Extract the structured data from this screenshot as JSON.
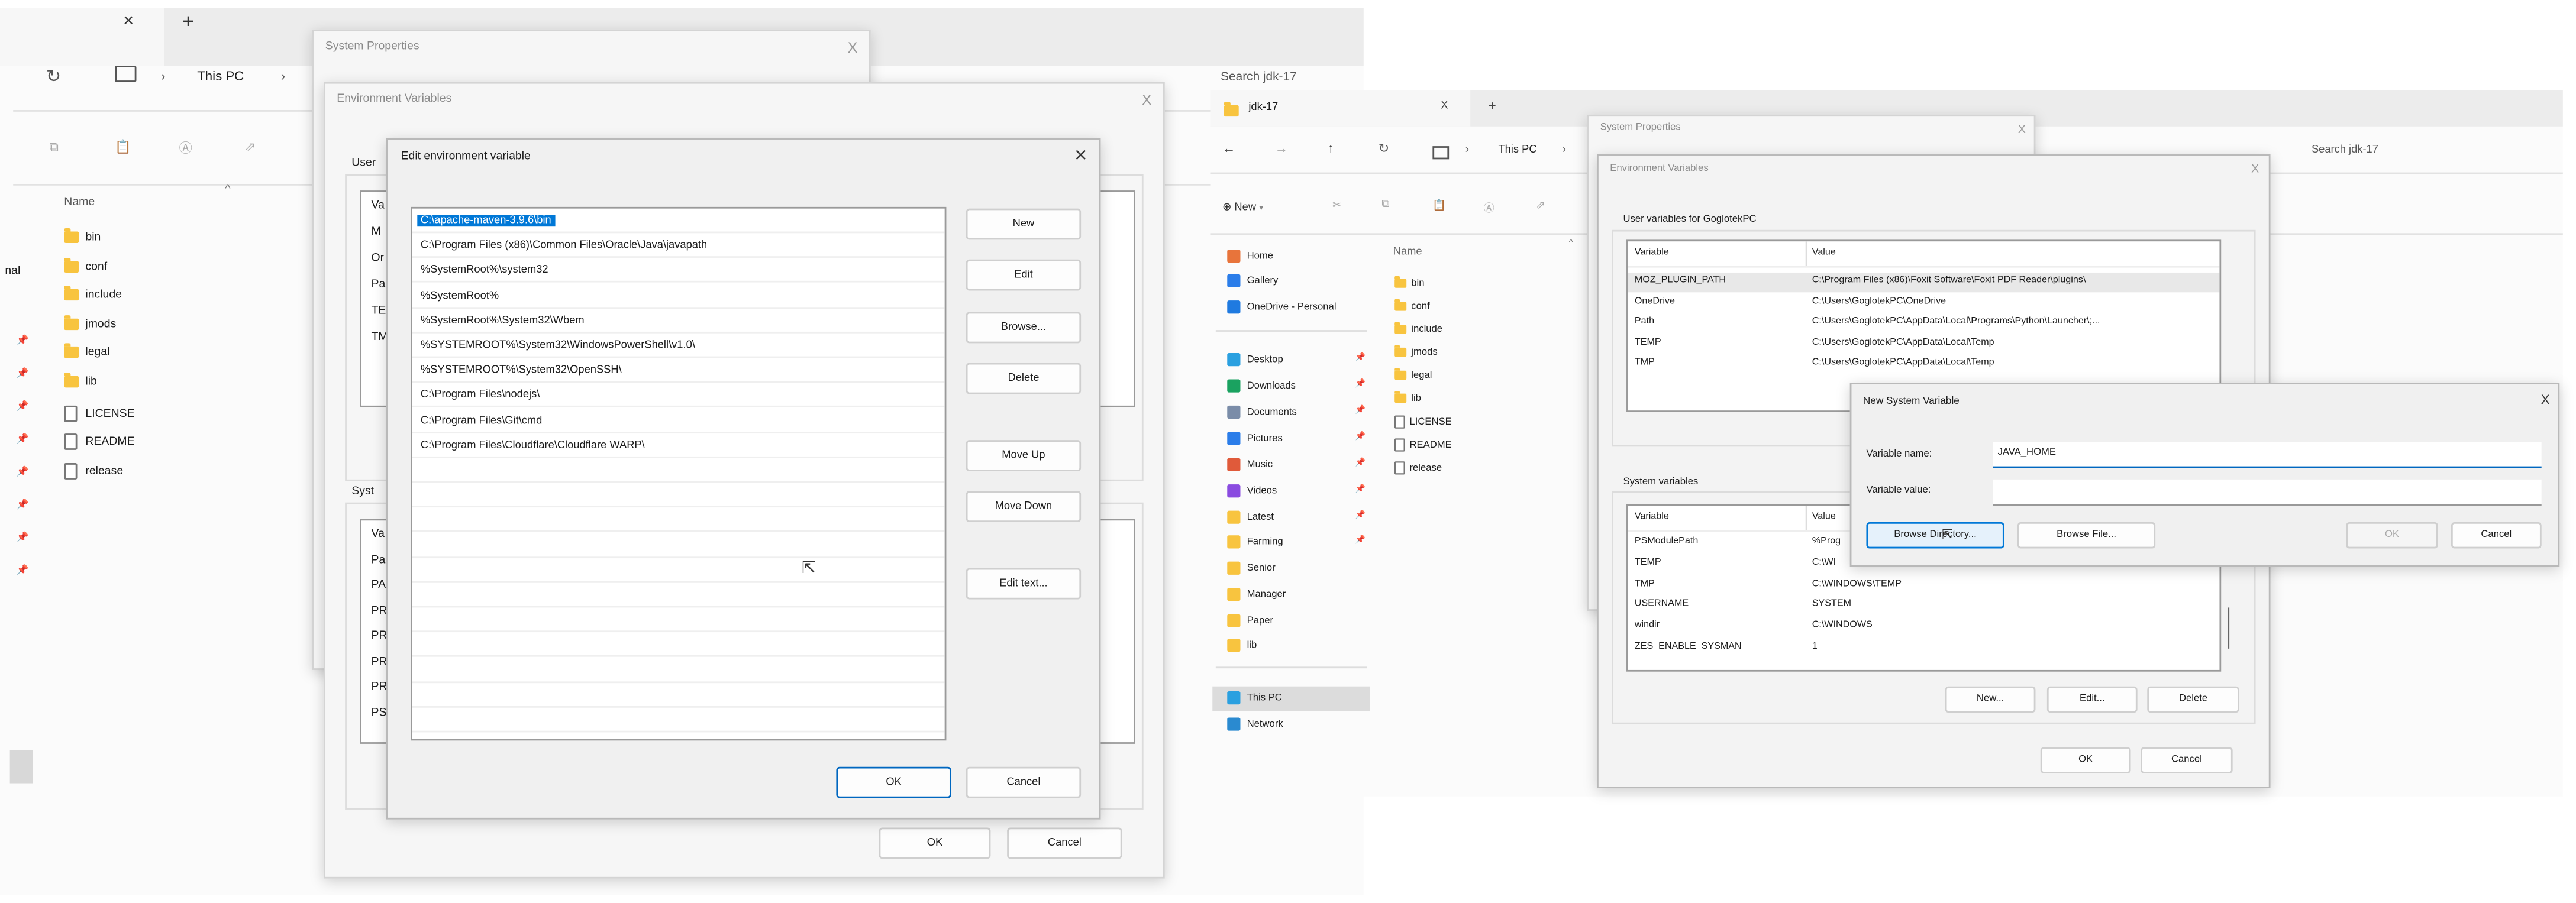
{
  "left_screen": {
    "tab_close": "×",
    "new_tab": "+",
    "breadcrumb": [
      "This PC"
    ],
    "search_placeholder": "Search jdk-17",
    "nav_partial": "nal",
    "column_name": "Name",
    "files": [
      {
        "name": "bin",
        "type": "folder"
      },
      {
        "name": "conf",
        "type": "folder"
      },
      {
        "name": "include",
        "type": "folder"
      },
      {
        "name": "jmods",
        "type": "folder"
      },
      {
        "name": "legal",
        "type": "folder"
      },
      {
        "name": "lib",
        "type": "folder"
      },
      {
        "name": "LICENSE",
        "type": "file"
      },
      {
        "name": "README",
        "type": "file"
      },
      {
        "name": "release",
        "type": "file"
      }
    ],
    "system_properties": {
      "title": "System Properties",
      "close": "X"
    },
    "environment_variables": {
      "title": "Environment Variables",
      "close": "X",
      "user_label": "User",
      "user_rows": [
        "Va",
        "M",
        "Or",
        "Pa",
        "TE",
        "TM"
      ],
      "system_label": "Syst",
      "system_rows": [
        "Va",
        "Pa",
        "PA",
        "PR",
        "PR",
        "PR",
        "PR",
        "PS"
      ],
      "ok": "OK",
      "cancel": "Cancel"
    },
    "edit_dialog": {
      "title": "Edit environment variable",
      "close": "✕",
      "entries": [
        "C:\\apache-maven-3.9.6\\bin",
        "C:\\Program Files (x86)\\Common Files\\Oracle\\Java\\javapath",
        "%SystemRoot%\\system32",
        "%SystemRoot%",
        "%SystemRoot%\\System32\\Wbem",
        "%SYSTEMROOT%\\System32\\WindowsPowerShell\\v1.0\\",
        "%SYSTEMROOT%\\System32\\OpenSSH\\",
        "C:\\Program Files\\nodejs\\",
        "C:\\Program Files\\Git\\cmd",
        "C:\\Program Files\\Cloudflare\\Cloudflare WARP\\"
      ],
      "selected_index": 0,
      "buttons": {
        "new": "New",
        "edit": "Edit",
        "browse": "Browse...",
        "delete": "Delete",
        "move_up": "Move Up",
        "move_down": "Move Down",
        "edit_text": "Edit text...",
        "ok": "OK",
        "cancel": "Cancel"
      }
    }
  },
  "right_screen": {
    "tab_title": "jdk-17",
    "tab_close": "X",
    "new_tab": "+",
    "breadcrumb": [
      "This PC"
    ],
    "search_placeholder": "Search jdk-17",
    "toolbar_new": "New",
    "nav": [
      {
        "label": "Home",
        "color": "#e8743b"
      },
      {
        "label": "Gallery",
        "color": "#2b7de9"
      },
      {
        "label": "OneDrive - Personal",
        "color": "#1f7ae0"
      },
      {
        "label": "Desktop",
        "color": "#2aa0e0",
        "pinned": true
      },
      {
        "label": "Downloads",
        "color": "#1aa260",
        "pinned": true
      },
      {
        "label": "Documents",
        "color": "#7a8ca8",
        "pinned": true
      },
      {
        "label": "Pictures",
        "color": "#2b7de9",
        "pinned": true
      },
      {
        "label": "Music",
        "color": "#e05a3a",
        "pinned": true
      },
      {
        "label": "Videos",
        "color": "#8a4be0",
        "pinned": true
      },
      {
        "label": "Latest",
        "color": "#f8c43f",
        "pinned": true
      },
      {
        "label": "Farming",
        "color": "#f8c43f",
        "pinned": true
      },
      {
        "label": "Senior",
        "color": "#f8c43f"
      },
      {
        "label": "Manager",
        "color": "#f8c43f"
      },
      {
        "label": "Paper",
        "color": "#f8c43f"
      },
      {
        "label": "lib",
        "color": "#f8c43f"
      },
      {
        "label": "This PC",
        "color": "#2aa0e0",
        "selected": true
      },
      {
        "label": "Network",
        "color": "#2a8ad0"
      }
    ],
    "column_name": "Name",
    "files": [
      {
        "name": "bin",
        "type": "folder"
      },
      {
        "name": "conf",
        "type": "folder"
      },
      {
        "name": "include",
        "type": "folder"
      },
      {
        "name": "jmods",
        "type": "folder"
      },
      {
        "name": "legal",
        "type": "folder"
      },
      {
        "name": "lib",
        "type": "folder"
      },
      {
        "name": "LICENSE",
        "type": "file"
      },
      {
        "name": "README",
        "type": "file"
      },
      {
        "name": "release",
        "type": "file"
      }
    ],
    "system_properties": {
      "title": "System Properties",
      "close": "X"
    },
    "environment_variables": {
      "title": "Environment Variables",
      "close": "X",
      "user_label": "User variables for GoglotekPC",
      "headers": [
        "Variable",
        "Value"
      ],
      "user_vars": [
        [
          "MOZ_PLUGIN_PATH",
          "C:\\Program Files (x86)\\Foxit Software\\Foxit PDF Reader\\plugins\\"
        ],
        [
          "OneDrive",
          "C:\\Users\\GoglotekPC\\OneDrive"
        ],
        [
          "Path",
          "C:\\Users\\GoglotekPC\\AppData\\Local\\Programs\\Python\\Launcher\\;..."
        ],
        [
          "TEMP",
          "C:\\Users\\GoglotekPC\\AppData\\Local\\Temp"
        ],
        [
          "TMP",
          "C:\\Users\\GoglotekPC\\AppData\\Local\\Temp"
        ]
      ],
      "system_label": "System variables",
      "system_vars": [
        [
          "PSModulePath",
          "%Prog"
        ],
        [
          "TEMP",
          "C:\\WI"
        ],
        [
          "TMP",
          "C:\\WINDOWS\\TEMP"
        ],
        [
          "USERNAME",
          "SYSTEM"
        ],
        [
          "windir",
          "C:\\WINDOWS"
        ],
        [
          "ZES_ENABLE_SYSMAN",
          "1"
        ]
      ],
      "buttons": {
        "new": "New...",
        "edit": "Edit...",
        "delete": "Delete",
        "ok": "OK",
        "cancel": "Cancel"
      }
    },
    "new_var_dialog": {
      "title": "New System Variable",
      "close": "X",
      "name_label": "Variable name:",
      "name_value": "JAVA_HOME",
      "value_label": "Variable value:",
      "value_value": "",
      "buttons": {
        "browse_dir": "Browse Directory...",
        "browse_file": "Browse File...",
        "ok": "OK",
        "cancel": "Cancel"
      }
    }
  }
}
